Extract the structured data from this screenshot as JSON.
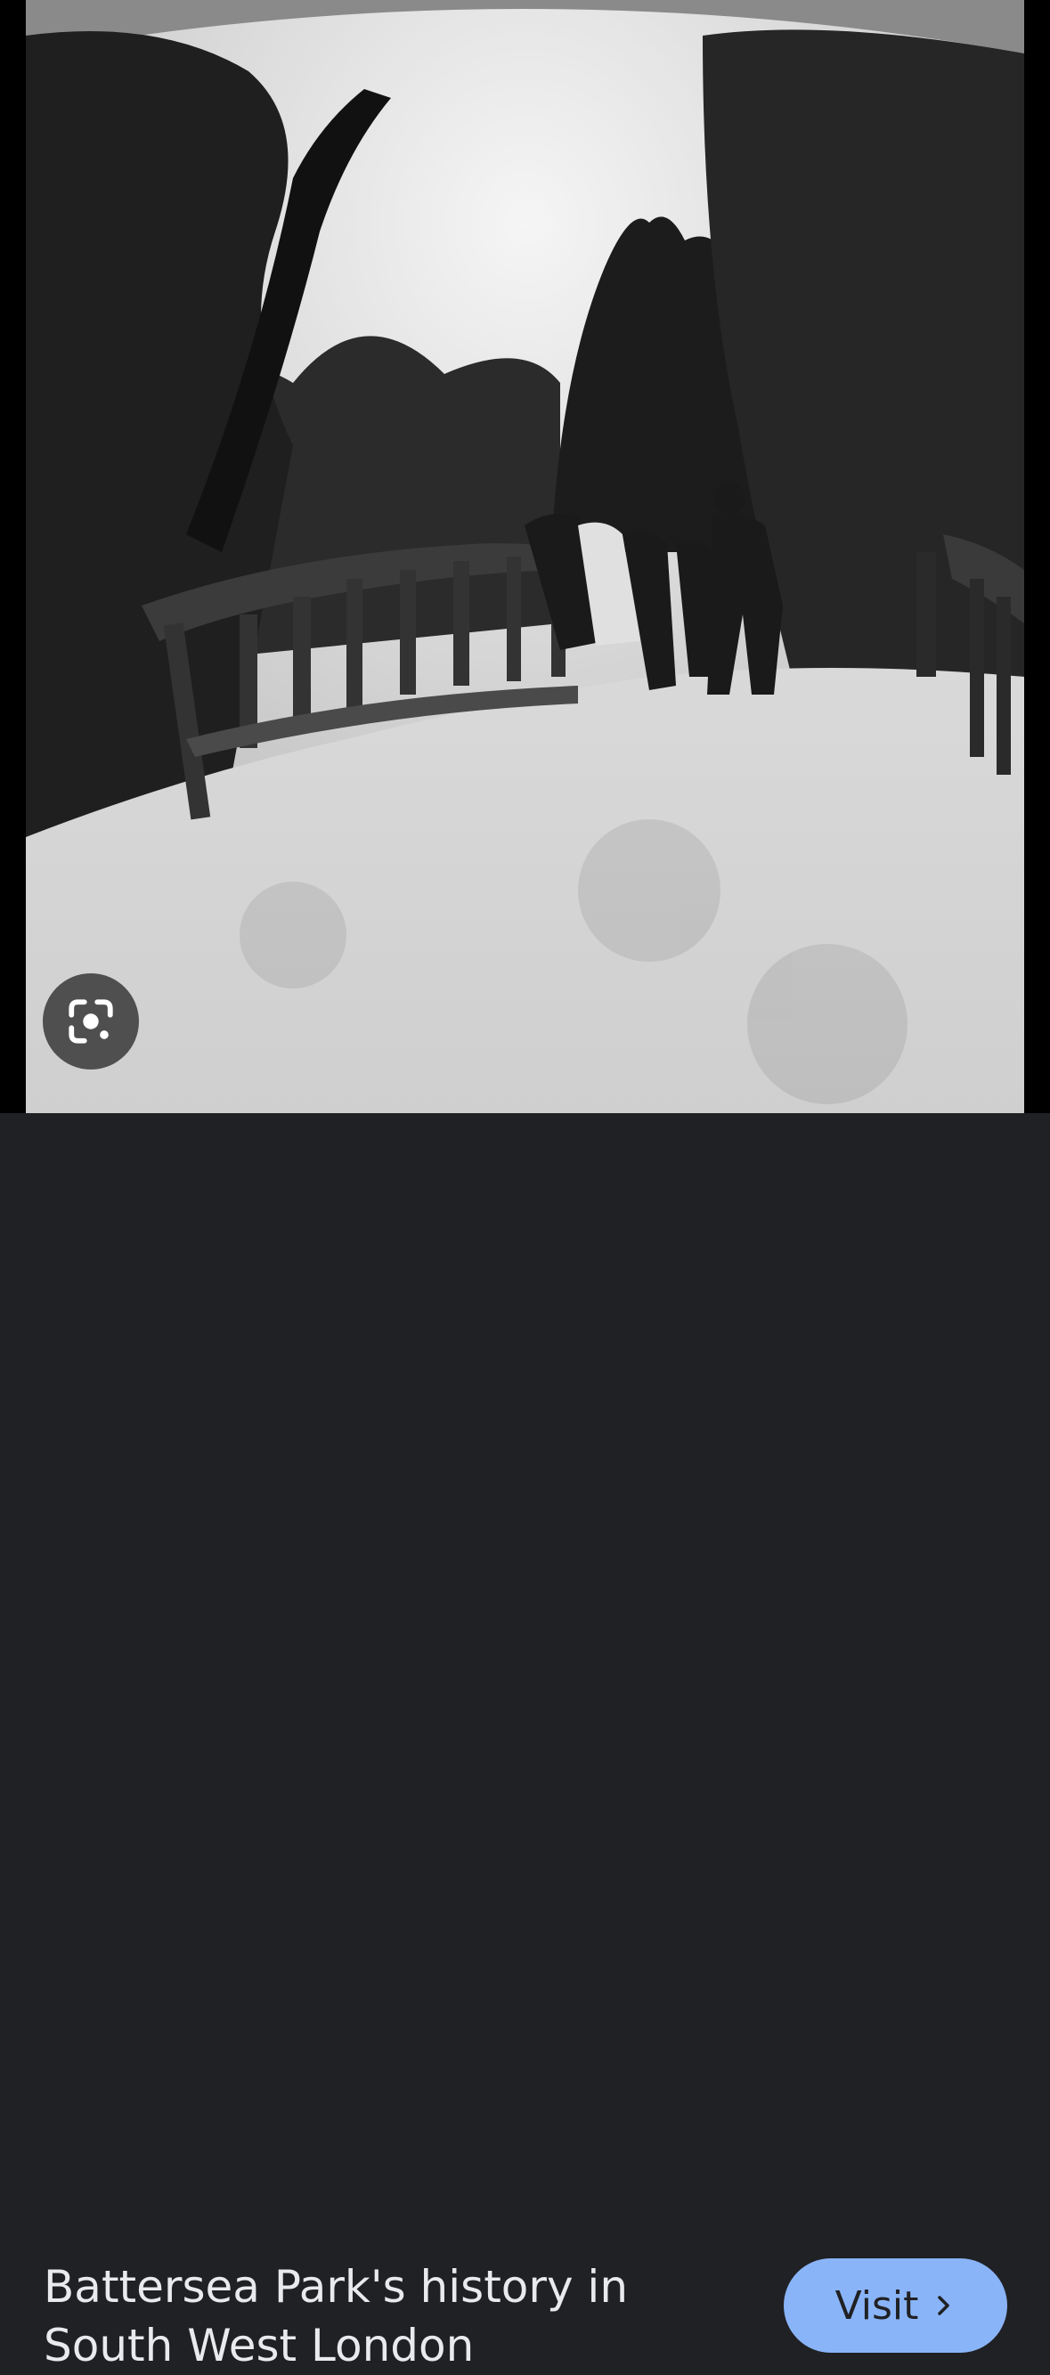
{
  "image": {
    "alt": "Black and white photo of people leaning on a rustic wooden bridge railing in a wooded park"
  },
  "lens_button": {
    "icon": "google-lens-icon"
  },
  "caption": {
    "line1": "Battersea Park's history in",
    "line2": "South West London"
  },
  "visit_button": {
    "label": "Visit",
    "icon": "chevron-right-icon",
    "color": "#8ab4f8"
  },
  "colors": {
    "bar_background": "#202124",
    "caption_text": "#e8eaed"
  }
}
